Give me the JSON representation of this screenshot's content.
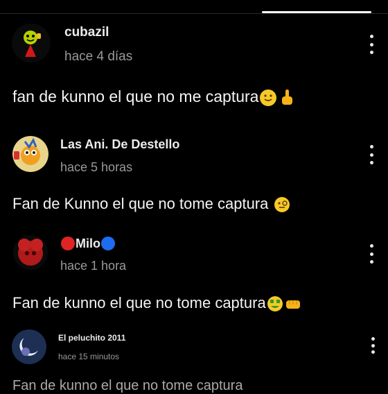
{
  "post": {
    "author": "cubazil",
    "time": "hace 4 días",
    "text": "fan de kunno el que no me captura"
  },
  "comments": [
    {
      "author": "Las Ani. De Destello",
      "time": "hace 5 horas",
      "text": "Fan de Kunno el que no tome captura"
    },
    {
      "author": "Milo",
      "time": "hace 1 hora",
      "text": "Fan de kunno el que no tome captura"
    },
    {
      "author": "El peluchito 2011",
      "time": "hace 15 minutos",
      "text": "Fan de kunno el que no tome captura"
    }
  ],
  "icons": {
    "options": "more-vertical-icon",
    "emoji_smile": "slightly-smiling-emoji",
    "emoji_finger": "index-pointing-up-emoji",
    "emoji_tongue": "money-mouth-emoji",
    "emoji_fist": "oncoming-fist-emoji",
    "emoji_monocle": "face-with-monocle-emoji",
    "red_circle": "red-circle-emoji",
    "blue_circle": "blue-circle-emoji"
  },
  "colors": {
    "background": "#000000",
    "text": "#f4f4f4",
    "muted": "#9a9a9a"
  }
}
